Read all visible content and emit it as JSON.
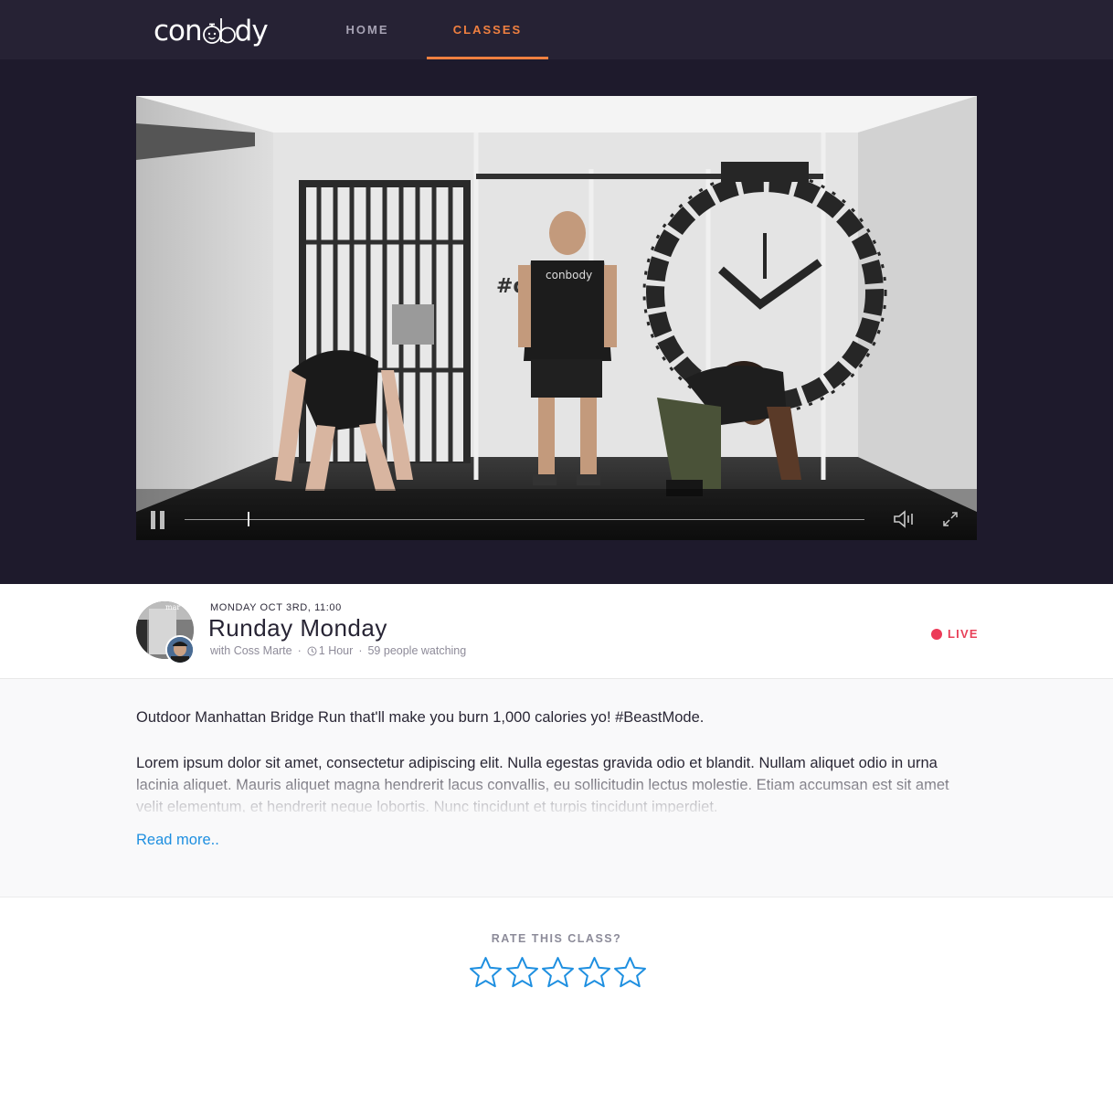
{
  "brand": {
    "logo_text": "con",
    "logo_text_tail": "dy",
    "accent": "#f08040"
  },
  "nav": {
    "items": [
      {
        "label": "HOME"
      },
      {
        "label": "CLASSES",
        "active": true
      }
    ]
  },
  "video": {
    "wall_text": "#d",
    "wall_text_tail": "e",
    "shirt_logo": "conbody",
    "progress": 0.093
  },
  "class_info": {
    "date": "MONDAY OCT 3RD, 11:00",
    "title": "Runday Monday",
    "instructor": "with Coss Marte",
    "duration": "1 Hour",
    "watching": "59 people watching",
    "status": "LIVE",
    "status_color": "#ec3a58",
    "avatar_caption": "mar"
  },
  "description": {
    "lead": "Outdoor Manhattan Bridge Run that'll make you burn 1,000 calories yo! #BeastMode.",
    "body": "Lorem ipsum dolor sit amet, consectetur adipiscing elit. Nulla egestas gravida odio et blandit. Nullam aliquet odio in urna lacinia aliquet. Mauris aliquet magna hendrerit lacus convallis, eu sollicitudin lectus molestie. Etiam accumsan est sit amet velit elementum, et hendrerit neque lobortis. Nunc tincidunt et turpis tincidunt imperdiet.",
    "read_more": "Read more.."
  },
  "rating": {
    "label": "RATE THIS CLASS?",
    "max": 5,
    "value": 0,
    "star_color": "#1e8fe0"
  }
}
